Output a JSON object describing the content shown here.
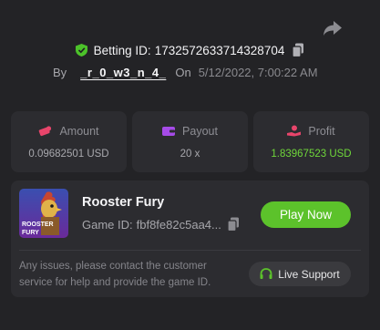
{
  "header": {
    "betting_id_label": "Betting ID:",
    "betting_id": "1732572633714328704",
    "by_label": "By",
    "username": "_r_0_w3_n_4_",
    "on_label": "On",
    "date": "5/12/2022, 7:00:22 AM"
  },
  "stats": [
    {
      "icon": "amount-icon",
      "label": "Amount",
      "value": "0.09682501 USD"
    },
    {
      "icon": "wallet-icon",
      "label": "Payout",
      "value": "20 x"
    },
    {
      "icon": "profit-icon",
      "label": "Profit",
      "value": "1.83967523 USD"
    }
  ],
  "game": {
    "name": "Rooster Fury",
    "id_label": "Game ID:",
    "id_value": "fbf8fe82c5aa4...",
    "thumbnail_text": "ROOSTER FURY",
    "play_label": "Play Now"
  },
  "support": {
    "text": "Any issues, please contact the customer service for help and provide the game ID.",
    "button_label": "Live Support"
  },
  "colors": {
    "background": "#232326",
    "card": "#2c2c30",
    "accent_green": "#5cc22b",
    "profit_green": "#6fd63a",
    "amount_icon": "#e8456b",
    "payout_icon": "#a64be8",
    "profit_icon": "#e8456b"
  }
}
